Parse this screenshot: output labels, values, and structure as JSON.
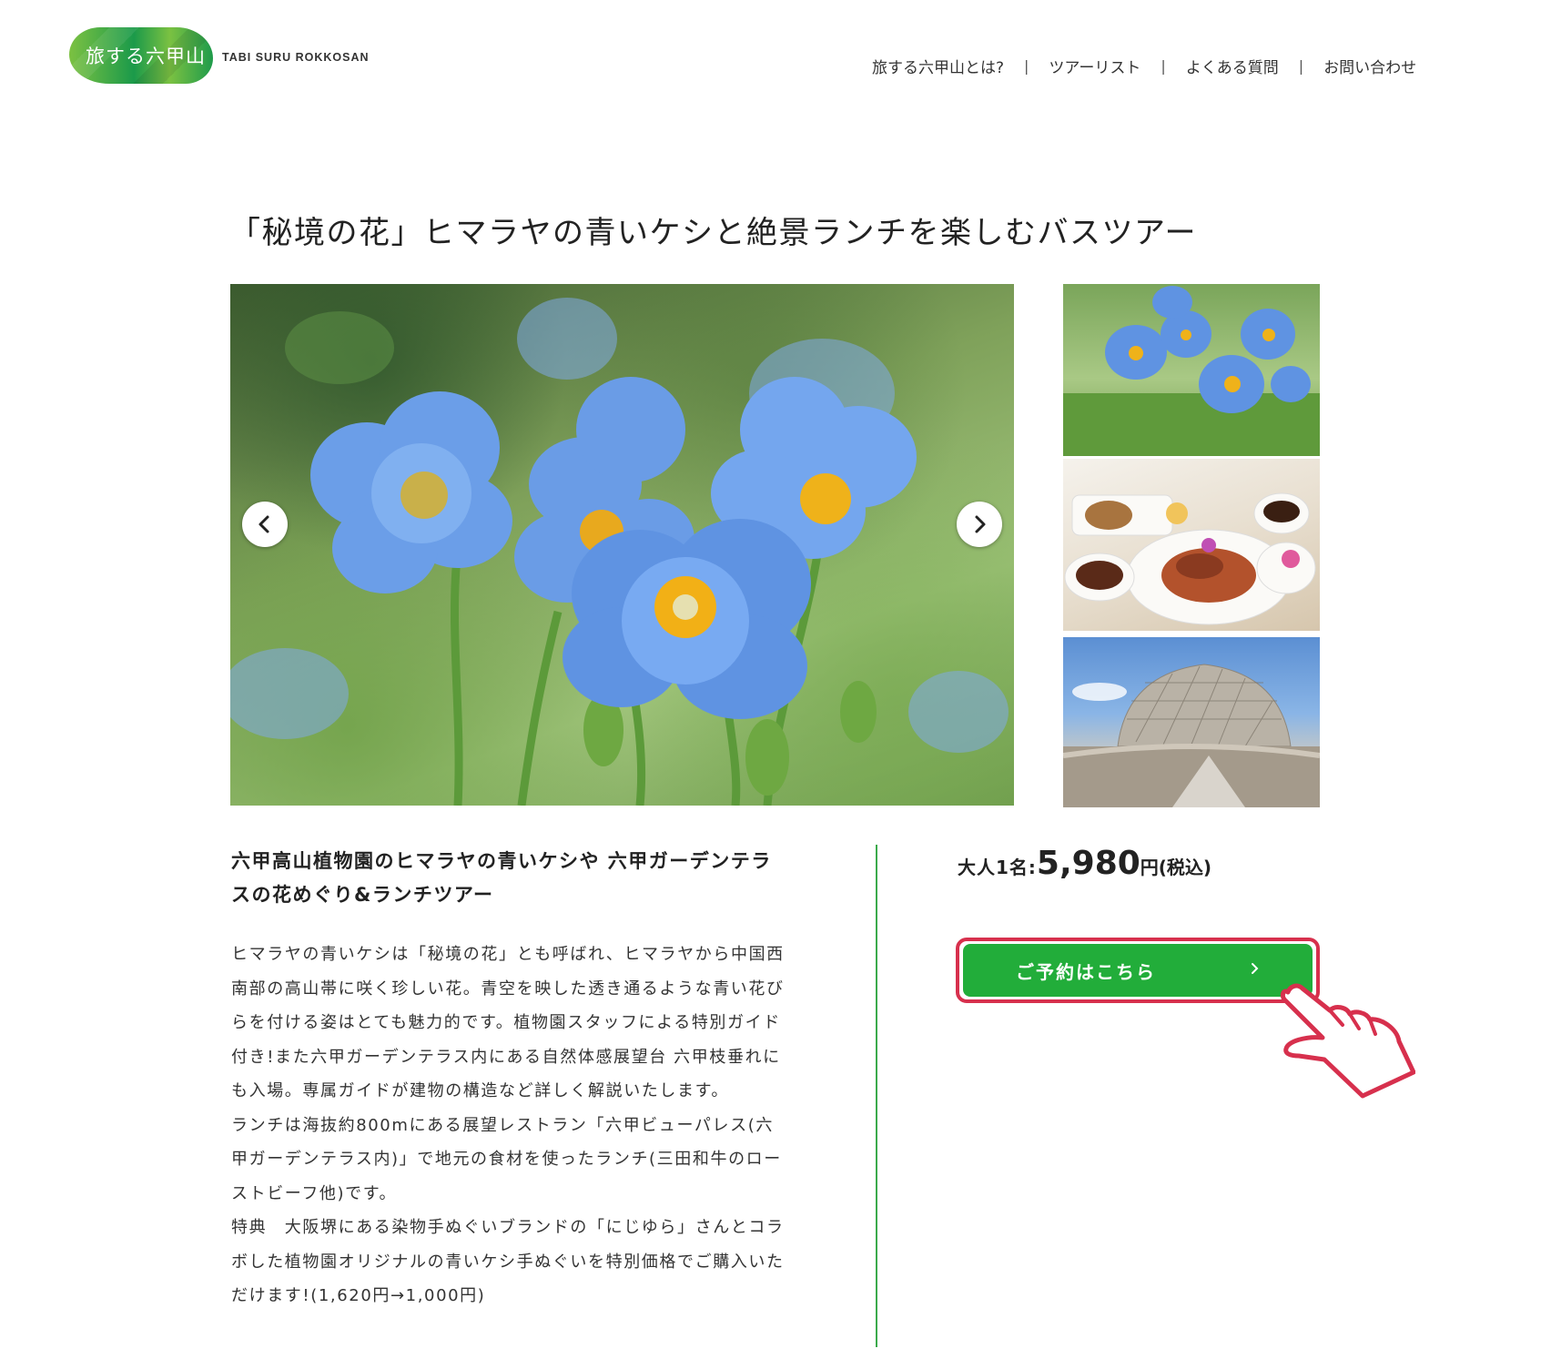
{
  "header": {
    "logo_text": "旅する六甲山",
    "logo_sub": "TABI SURU ROKKOSAN",
    "nav": [
      {
        "label": "旅する六甲山とは?"
      },
      {
        "label": "ツアーリスト"
      },
      {
        "label": "よくある質問"
      },
      {
        "label": "お問い合わせ"
      }
    ],
    "nav_separator": "|"
  },
  "page": {
    "title": "「秘境の花」ヒマラヤの青いケシと絶景ランチを楽しむバスツアー"
  },
  "gallery": {
    "prev_icon": "chevron-left-icon",
    "next_icon": "chevron-right-icon"
  },
  "description": {
    "subtitle": "六甲高山植物園のヒマラヤの青いケシや 六甲ガーデンテラスの花めぐり&ランチツアー",
    "body": "ヒマラヤの青いケシは「秘境の花」とも呼ばれ、ヒマラヤから中国西南部の高山帯に咲く珍しい花。青空を映した透き通るような青い花びらを付ける姿はとても魅力的です。植物園スタッフによる特別ガイド付き!また六甲ガーデンテラス内にある自然体感展望台 六甲枝垂れにも入場。専属ガイドが建物の構造など詳しく解説いたします。\nランチは海抜約800mにある展望レストラン「六甲ビューパレス(六甲ガーデンテラス内)」で地元の食材を使ったランチ(三田和牛のローストビーフ他)です。\n特典　大阪堺にある染物手ぬぐいブランドの「にじゆら」さんとコラボした植物園オリジナルの青いケシ手ぬぐいを特別価格でご購入いただけます!(1,620円→1,000円)"
  },
  "booking": {
    "price_label": "大人1名:",
    "price_value": "5,980",
    "price_unit": "円(税込)",
    "button_label": "ご予約はこちら",
    "button_icon": "chevron-right-icon",
    "pointer_icon": "pointing-hand-icon"
  },
  "colors": {
    "brand_green": "#22ad3a",
    "highlight_red": "#d7304d",
    "divider_green": "#3aaa4b"
  }
}
